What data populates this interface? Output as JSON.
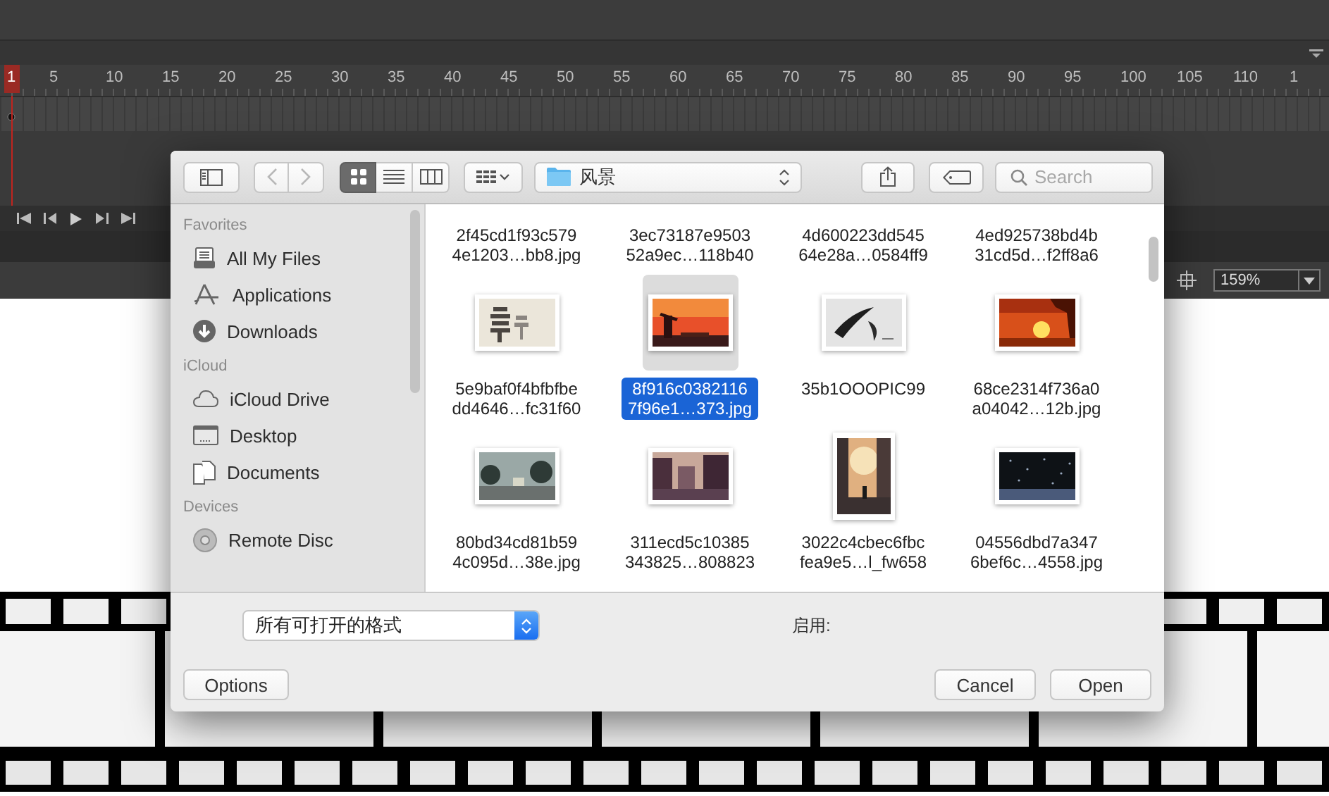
{
  "timeline": {
    "ruler": [
      "1",
      "5",
      "10",
      "15",
      "20",
      "25",
      "30",
      "35",
      "40",
      "45",
      "50",
      "55",
      "60",
      "65",
      "70",
      "75",
      "80",
      "85",
      "90",
      "95",
      "100",
      "105",
      "110",
      "1"
    ]
  },
  "stage": {
    "zoom": "159%"
  },
  "dialog": {
    "toolbar": {
      "back": {
        "disabled": true
      },
      "forward": {
        "disabled": true
      },
      "view_modes": [
        {
          "kind": "icons",
          "selected": true
        },
        {
          "kind": "list",
          "selected": false
        },
        {
          "kind": "columns",
          "selected": false
        }
      ],
      "location": "风景",
      "search": {
        "placeholder": "Search"
      }
    },
    "sidebar": [
      {
        "title": "Favorites",
        "items": [
          {
            "label": "All My Files",
            "kind": "files"
          },
          {
            "label": "Applications",
            "kind": "apps"
          },
          {
            "label": "Downloads",
            "kind": "downloads"
          }
        ]
      },
      {
        "title": "iCloud",
        "items": [
          {
            "label": "iCloud Drive",
            "kind": "cloud"
          },
          {
            "label": "Desktop",
            "kind": "desktop"
          },
          {
            "label": "Documents",
            "kind": "documents"
          }
        ]
      },
      {
        "title": "Devices",
        "items": [
          {
            "label": "Remote Disc",
            "kind": "disc"
          }
        ]
      }
    ],
    "files": [
      {
        "name": "2f45cd1f93c579\n4e1203…bb8.jpg",
        "kind": "text",
        "selected": false
      },
      {
        "name": "3ec73187e9503\n52a9ec…118b40",
        "kind": "text",
        "selected": false
      },
      {
        "name": "4d600223dd545\n64e28a…0584ff9",
        "kind": "text",
        "selected": false
      },
      {
        "name": "4ed925738bd4b\n31cd5d…f2ff8a6",
        "kind": "text",
        "selected": false
      },
      {
        "name": "5e9baf0f4bfbfbe\ndd4646…fc31f60",
        "kind": "picture",
        "selected": false
      },
      {
        "name": "8f916c0382116\n7f96e1…373.jpg",
        "kind": "picture",
        "selected": true
      },
      {
        "name": "35b1OOOPIC99",
        "kind": "picture",
        "selected": false
      },
      {
        "name": "68ce2314f736a0\na04042…12b.jpg",
        "kind": "picture",
        "selected": false
      },
      {
        "name": "80bd34cd81b59\n4c095d…38e.jpg",
        "kind": "picture",
        "selected": false
      },
      {
        "name": "311ecd5c10385\n343825…808823",
        "kind": "picture",
        "selected": false
      },
      {
        "name": "3022c4cbec6fbc\nfea9e5…l_fw658",
        "kind": "picture",
        "selected": false
      },
      {
        "name": "04556dbd7a347\n6bef6c…4558.jpg",
        "kind": "picture",
        "selected": false
      }
    ],
    "format": "所有可打开的格式",
    "enable_label": "启用:",
    "buttons": [
      {
        "label": "Options"
      },
      {
        "label": "Cancel"
      },
      {
        "label": "Open"
      }
    ]
  }
}
